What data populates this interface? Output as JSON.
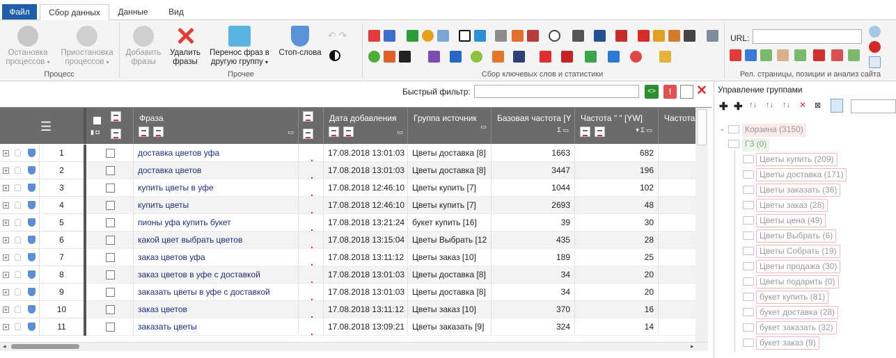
{
  "menu": {
    "file": "Файл",
    "tabs": [
      "Сбор данных",
      "Данные",
      "Вид"
    ]
  },
  "ribbon": {
    "process": {
      "label": "Процесс",
      "stop": [
        "Остановка",
        "процессов"
      ],
      "pause": [
        "Приостановка",
        "процессов"
      ]
    },
    "other": {
      "label": "Прочее",
      "add": [
        "Добавить",
        "фразы"
      ],
      "delete": [
        "Удалить",
        "фразы"
      ],
      "move": [
        "Перенос фраз в",
        "другую группу"
      ],
      "stopwords": "Стоп-слова"
    },
    "collect_label": "Сбор ключевых слов и статистики",
    "rel_label": "Рел. страницы, позиции и анализ сайта",
    "url_label": "URL:",
    "url_value": ""
  },
  "filter": {
    "label": "Быстрый фильтр:",
    "value": ""
  },
  "grid": {
    "columns": [
      "Фраза",
      "Дата добавления",
      "Группа источник",
      "Базовая частота [Y",
      "Частота \" \" [YW]",
      "Частота"
    ],
    "sigma": "Σ",
    "rows": [
      {
        "n": "1",
        "phrase": "доставка цветов уфа",
        "date": "17.08.2018 13:01:03",
        "group": "Цветы доставка [8]",
        "base": "1663",
        "freq": "682"
      },
      {
        "n": "2",
        "phrase": "доставка цветов",
        "date": "17.08.2018 13:01:03",
        "group": "Цветы доставка [8]",
        "base": "3447",
        "freq": "196"
      },
      {
        "n": "3",
        "phrase": "купить цветы в уфе",
        "date": "17.08.2018 12:46:10",
        "group": "Цветы купить [7]",
        "base": "1044",
        "freq": "102"
      },
      {
        "n": "4",
        "phrase": "купить цветы",
        "date": "17.08.2018 12:46:10",
        "group": "Цветы купить [7]",
        "base": "2693",
        "freq": "48"
      },
      {
        "n": "5",
        "phrase": "пионы уфа купить букет",
        "date": "17.08.2018 13:21:24",
        "group": "букет купить [16]",
        "base": "39",
        "freq": "30"
      },
      {
        "n": "6",
        "phrase": "какой цвет выбрать цветов",
        "date": "17.08.2018 13:15:04",
        "group": "Цветы Выбрать [12",
        "base": "435",
        "freq": "28"
      },
      {
        "n": "7",
        "phrase": "заказ цветов уфа",
        "date": "17.08.2018 13:11:12",
        "group": "Цветы заказ [10]",
        "base": "189",
        "freq": "25"
      },
      {
        "n": "8",
        "phrase": "заказ цветов в уфе с доставкой",
        "date": "17.08.2018 13:01:03",
        "group": "Цветы доставка [8]",
        "base": "34",
        "freq": "20"
      },
      {
        "n": "9",
        "phrase": "заказать цветы в уфе с доставкой",
        "date": "17.08.2018 13:01:03",
        "group": "Цветы доставка [8]",
        "base": "34",
        "freq": "20"
      },
      {
        "n": "10",
        "phrase": "заказ цветов",
        "date": "17.08.2018 13:11:12",
        "group": "Цветы заказ [10]",
        "base": "370",
        "freq": "16"
      },
      {
        "n": "11",
        "phrase": "заказать цветы",
        "date": "17.08.2018 13:09:21",
        "group": "Цветы заказать [9]",
        "base": "324",
        "freq": "14"
      }
    ]
  },
  "groups_panel": {
    "title": "Управление группами",
    "root_nodes": [
      "Корзина (3150)",
      "Г3 (0)"
    ],
    "children": [
      "Цветы купить (209)",
      "Цветы доставка (171)",
      "Цветы заказать (36)",
      "Цветы заказ (28)",
      "Цветы цена (49)",
      "Цветы Выбрать (6)",
      "Цветы Собрать (19)",
      "Цветы продажа (30)",
      "Цветы подарить (0)",
      "букет купить (81)",
      "букет доставка (28)",
      "букет заказать (32)",
      "букет заказ (9)"
    ]
  },
  "colors": {
    "accent": "#1f5ea8",
    "header": "#6b6b6b",
    "tree_border": "#f1b8b8",
    "phrase": "#1a2f7a",
    "bars": "#d12a2a"
  }
}
